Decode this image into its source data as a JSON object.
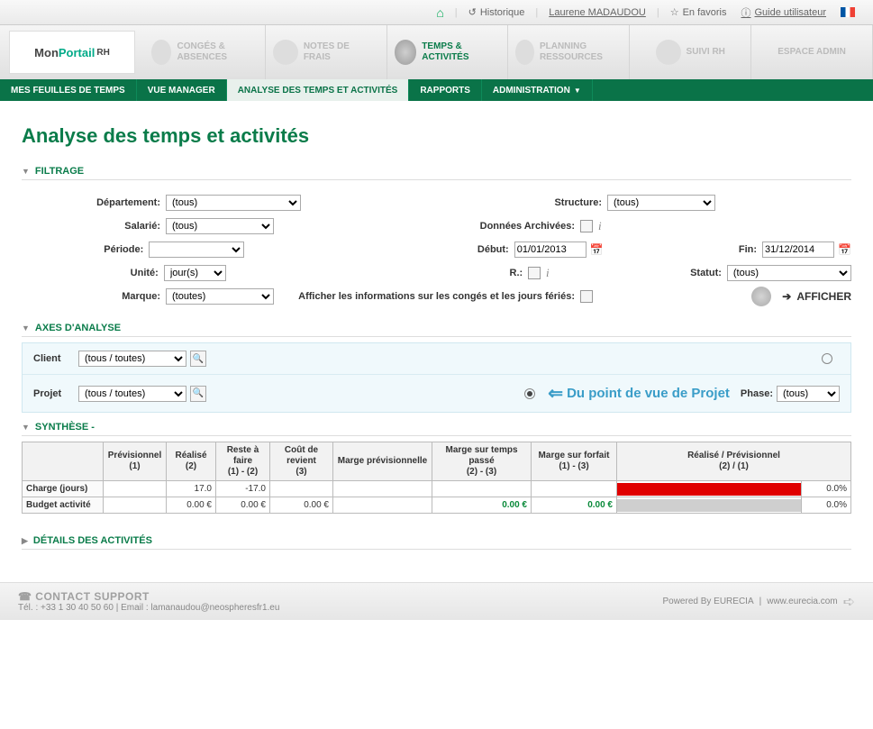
{
  "topbar": {
    "history": "Historique",
    "user": "Laurene MADAUDOU",
    "favorites": "En favoris",
    "guide": "Guide utilisateur"
  },
  "logo": {
    "mon": "Mon",
    "portail": "Portail",
    "rh": "RH"
  },
  "modules": {
    "conges": "CONGÉS & ABSENCES",
    "notes": "NOTES DE FRAIS",
    "temps": "TEMPS & ACTIVITÉS",
    "planning": "PLANNING RESSOURCES",
    "suivi": "SUIVI RH",
    "espace": "ESPACE ADMIN"
  },
  "nav": {
    "feuilles": "MES FEUILLES DE TEMPS",
    "manager": "VUE MANAGER",
    "analyse": "ANALYSE DES TEMPS ET ACTIVITÉS",
    "rapports": "RAPPORTS",
    "admin": "ADMINISTRATION"
  },
  "page_title": "Analyse des temps et activités",
  "sections": {
    "filtrage": "FILTRAGE",
    "axes": "AXES D'ANALYSE",
    "synthese": "SYNTHÈSE -",
    "details": "DÉTAILS DES ACTIVITÉS"
  },
  "filters": {
    "departement_label": "Département:",
    "departement_value": "(tous)",
    "structure_label": "Structure:",
    "structure_value": "(tous)",
    "salarie_label": "Salarié:",
    "salarie_value": "(tous)",
    "donnees_label": "Données Archivées:",
    "periode_label": "Période:",
    "periode_value": "",
    "debut_label": "Début:",
    "debut_value": "01/01/2013",
    "fin_label": "Fin:",
    "fin_value": "31/12/2014",
    "unite_label": "Unité:",
    "unite_value": "jour(s)",
    "r_label": "R.:",
    "statut_label": "Statut:",
    "statut_value": "(tous)",
    "marque_label": "Marque:",
    "marque_value": "(toutes)",
    "afficher_infos_label": "Afficher les informations sur les congés et les jours fériés:",
    "afficher_btn": "AFFICHER"
  },
  "axes": {
    "client_label": "Client",
    "client_value": "(tous / toutes)",
    "projet_label": "Projet",
    "projet_value": "(tous / toutes)",
    "pov": "Du point de vue de Projet",
    "phase_label": "Phase:",
    "phase_value": "(tous)"
  },
  "table": {
    "headers": {
      "c0": "",
      "c1": "Prévisionnel\n(1)",
      "c2": "Réalisé\n(2)",
      "c3": "Reste à faire\n(1) - (2)",
      "c4": "Coût de revient\n(3)",
      "c5": "Marge prévisionnelle",
      "c6": "Marge sur temps passé\n(2) - (3)",
      "c7": "Marge sur forfait\n(1) - (3)",
      "c8": "Réalisé / Prévisionnel\n(2) / (1)"
    },
    "row1": {
      "label": "Charge (jours)",
      "c1": "",
      "c2": "17.0",
      "c3": "-17.0",
      "c4": "",
      "c5": "",
      "c6": "",
      "c7": "",
      "c8pct": "0.0%"
    },
    "row2": {
      "label": "Budget activité",
      "c1": "",
      "c2": "0.00 €",
      "c3": "0.00 €",
      "c4": "0.00 €",
      "c5": "",
      "c6": "0.00 €",
      "c7": "0.00 €",
      "c8pct": "0.0%"
    }
  },
  "footer": {
    "contact": "CONTACT SUPPORT",
    "tel": "Tél. : +33 1 30 40 50 60  |  Email : lamanaudou@neospheresfr1.eu",
    "powered": "Powered By EURECIA",
    "site": "www.eurecia.com"
  }
}
